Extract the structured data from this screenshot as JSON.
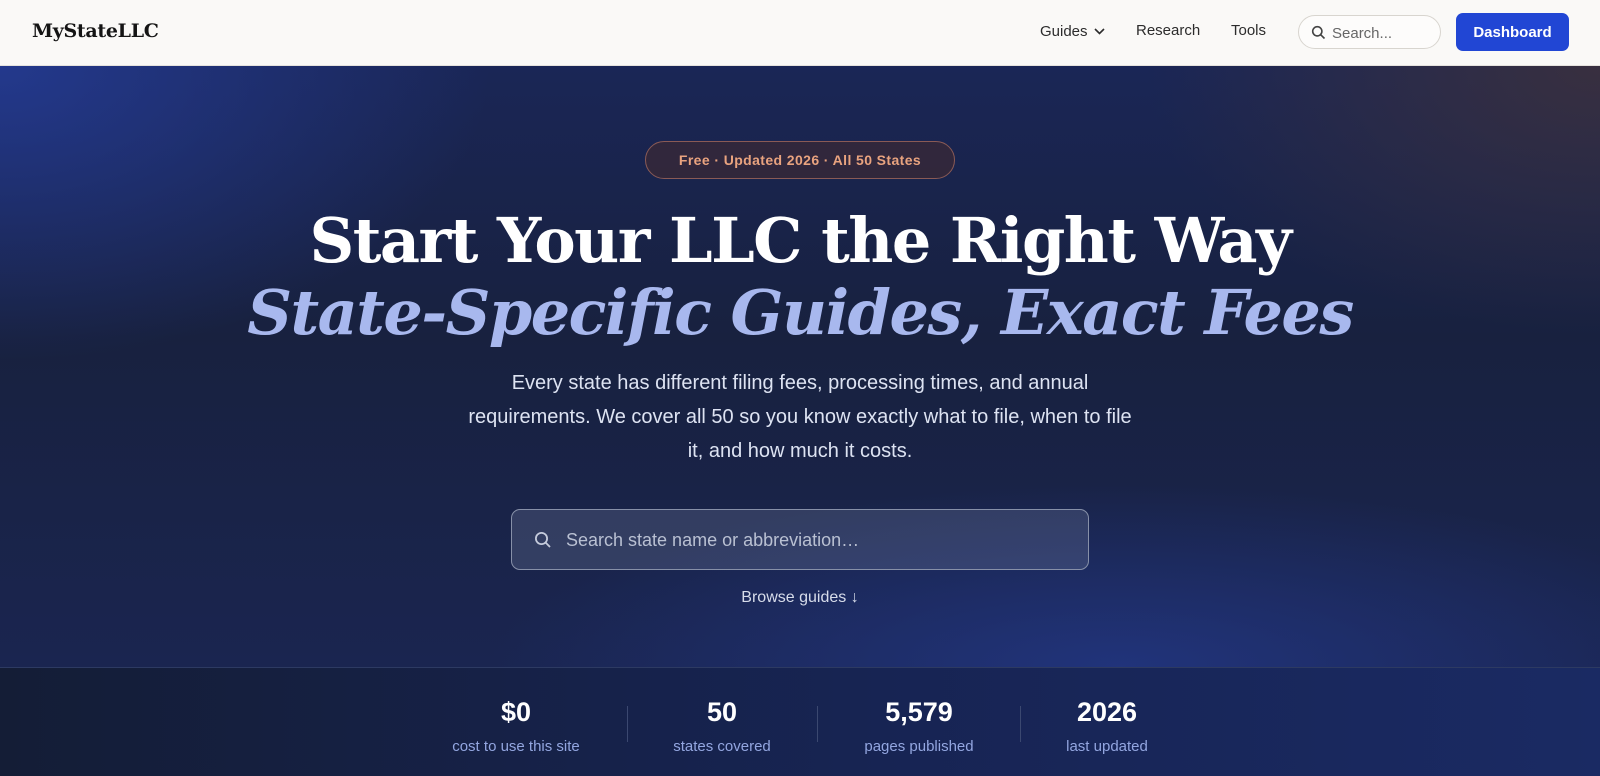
{
  "nav": {
    "logo": "MyStateLLC",
    "links": [
      "Guides",
      "Research",
      "Tools"
    ],
    "search_placeholder": "Search...",
    "dashboard_label": "Dashboard"
  },
  "hero": {
    "badge": "Free · Updated 2026 · All 50 States",
    "headline_line1": "Start Your LLC the Right Way",
    "headline_line2": "State-Specific Guides, Exact Fees",
    "lead": "Every state has different filing fees, processing times, and annual requirements. We cover all 50 so you know exactly what to file, when to file it, and how much it costs.",
    "search_placeholder": "Search state name or abbreviation…",
    "browse_label": "Browse guides ↓"
  },
  "stats": [
    {
      "value": "$0",
      "label": "cost to use this site"
    },
    {
      "value": "50",
      "label": "states covered"
    },
    {
      "value": "5,579",
      "label": "pages published"
    },
    {
      "value": "2026",
      "label": "last updated"
    }
  ],
  "colors": {
    "accent": "#2146d4",
    "badge_text": "#e9a37f",
    "headline_italic": "#a8b8ee",
    "stat_label": "#93a6e0"
  }
}
